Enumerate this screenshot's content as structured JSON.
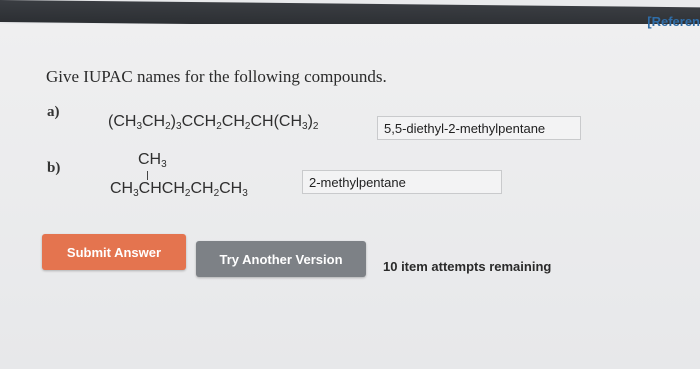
{
  "header": {
    "reference_label": "[Referen"
  },
  "question": {
    "prompt": "Give IUPAC names for the following compounds.",
    "parts": [
      {
        "label": "a)",
        "formula_html": "(CH<sub>3</sub>CH<sub>2</sub>)<sub>3</sub>CCH<sub>2</sub>CH<sub>2</sub>CH(CH<sub>3</sub>)<sub>2</sub>",
        "answer": "5,5-diethyl-2-methylpentane"
      },
      {
        "label": "b)",
        "formula_top_html": "CH<sub>3</sub>",
        "formula_main_html": "CH<sub>3</sub>CHCH<sub>2</sub>CH<sub>2</sub>CH<sub>3</sub>",
        "answer": "2-methylpentane"
      }
    ]
  },
  "actions": {
    "submit_label": "Submit Answer",
    "try_label": "Try Another Version",
    "attempts_text": "10 item attempts remaining"
  },
  "colors": {
    "submit_bg": "#e4744f",
    "try_bg": "#7d8186",
    "reference": "#2f6da8"
  }
}
